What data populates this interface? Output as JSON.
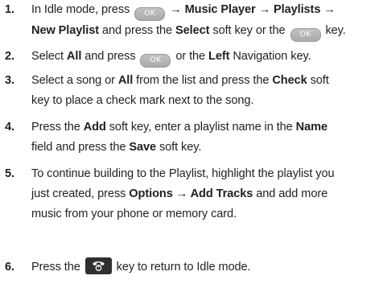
{
  "keys": {
    "ok_label": "OK"
  },
  "steps": [
    {
      "num": "1.",
      "l1a": "In Idle mode, press ",
      "arrow1": " → ",
      "music_player": "Music Player",
      "arrow2": " → ",
      "playlists": "Playlists",
      "arrow3": " →",
      "new_playlist": "New Playlist",
      "l2b": " and press the ",
      "select": "Select",
      "l2c": " soft key or the ",
      "l2d": " key."
    },
    {
      "num": "2.",
      "l1a": "Select ",
      "all": "All",
      "l1b": " and press ",
      "l1c": " or the ",
      "left": "Left",
      "l1d": " Navigation key."
    },
    {
      "num": "3.",
      "l1a": "Select a song or ",
      "all": "All",
      "l1b": " from the list and press the ",
      "check": "Check",
      "l1c": " soft",
      "l2": "key to place a check mark next to the song."
    },
    {
      "num": "4.",
      "l1a": "Press the ",
      "add": "Add",
      "l1b": " soft key, enter a playlist name in the ",
      "name": "Name",
      "l2a": "field and press the ",
      "save": "Save",
      "l2b": " soft key."
    },
    {
      "num": "5.",
      "l1": "To continue building to the Playlist, highlight the playlist you",
      "l2a": "just created, press ",
      "options": "Options",
      "arrow": " → ",
      "add_tracks": "Add Tracks",
      "l2b": " and add more",
      "l3": "music from your phone or memory card."
    },
    {
      "num": "6.",
      "l1a": "Press the ",
      "l1b": " key to return to Idle mode."
    }
  ],
  "icons": {
    "ok": "ok-key-icon",
    "end": "end-power-key-icon"
  }
}
